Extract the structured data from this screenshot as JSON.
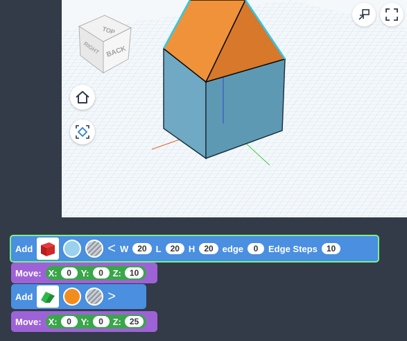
{
  "viewcube": {
    "top": "TOP",
    "back": "BACK",
    "right": "RIGHT"
  },
  "view_controls": {
    "home_icon": "home-icon",
    "fit_icon": "fit-view-icon",
    "minimize_icon": "minimize-icon",
    "fullscreen_icon": "fullscreen-icon"
  },
  "blocks": {
    "add1": {
      "label": "Add",
      "shape": "box",
      "color": "#9ad1ec",
      "color_label": "light-blue",
      "w_label": "W",
      "w": "20",
      "l_label": "L",
      "l": "20",
      "h_label": "H",
      "h": "20",
      "edge_label": "edge",
      "edge": "0",
      "steps_label": "Edge Steps",
      "steps": "10"
    },
    "move1": {
      "label": "Move:",
      "x_label": "X:",
      "x": "0",
      "y_label": "Y:",
      "y": "0",
      "z_label": "Z:",
      "z": "10"
    },
    "add2": {
      "label": "Add",
      "shape": "roof",
      "color": "#f28d1c",
      "color_label": "orange"
    },
    "move2": {
      "label": "Move:",
      "x_label": "X:",
      "x": "0",
      "y_label": "Y:",
      "y": "0",
      "z_label": "Z:",
      "z": "25"
    }
  },
  "colors": {
    "add_block": "#4a8fe0",
    "move_block": "#9d63d6",
    "xyz_group": "#3aa64a",
    "selected_outline": "#7cf08a"
  }
}
